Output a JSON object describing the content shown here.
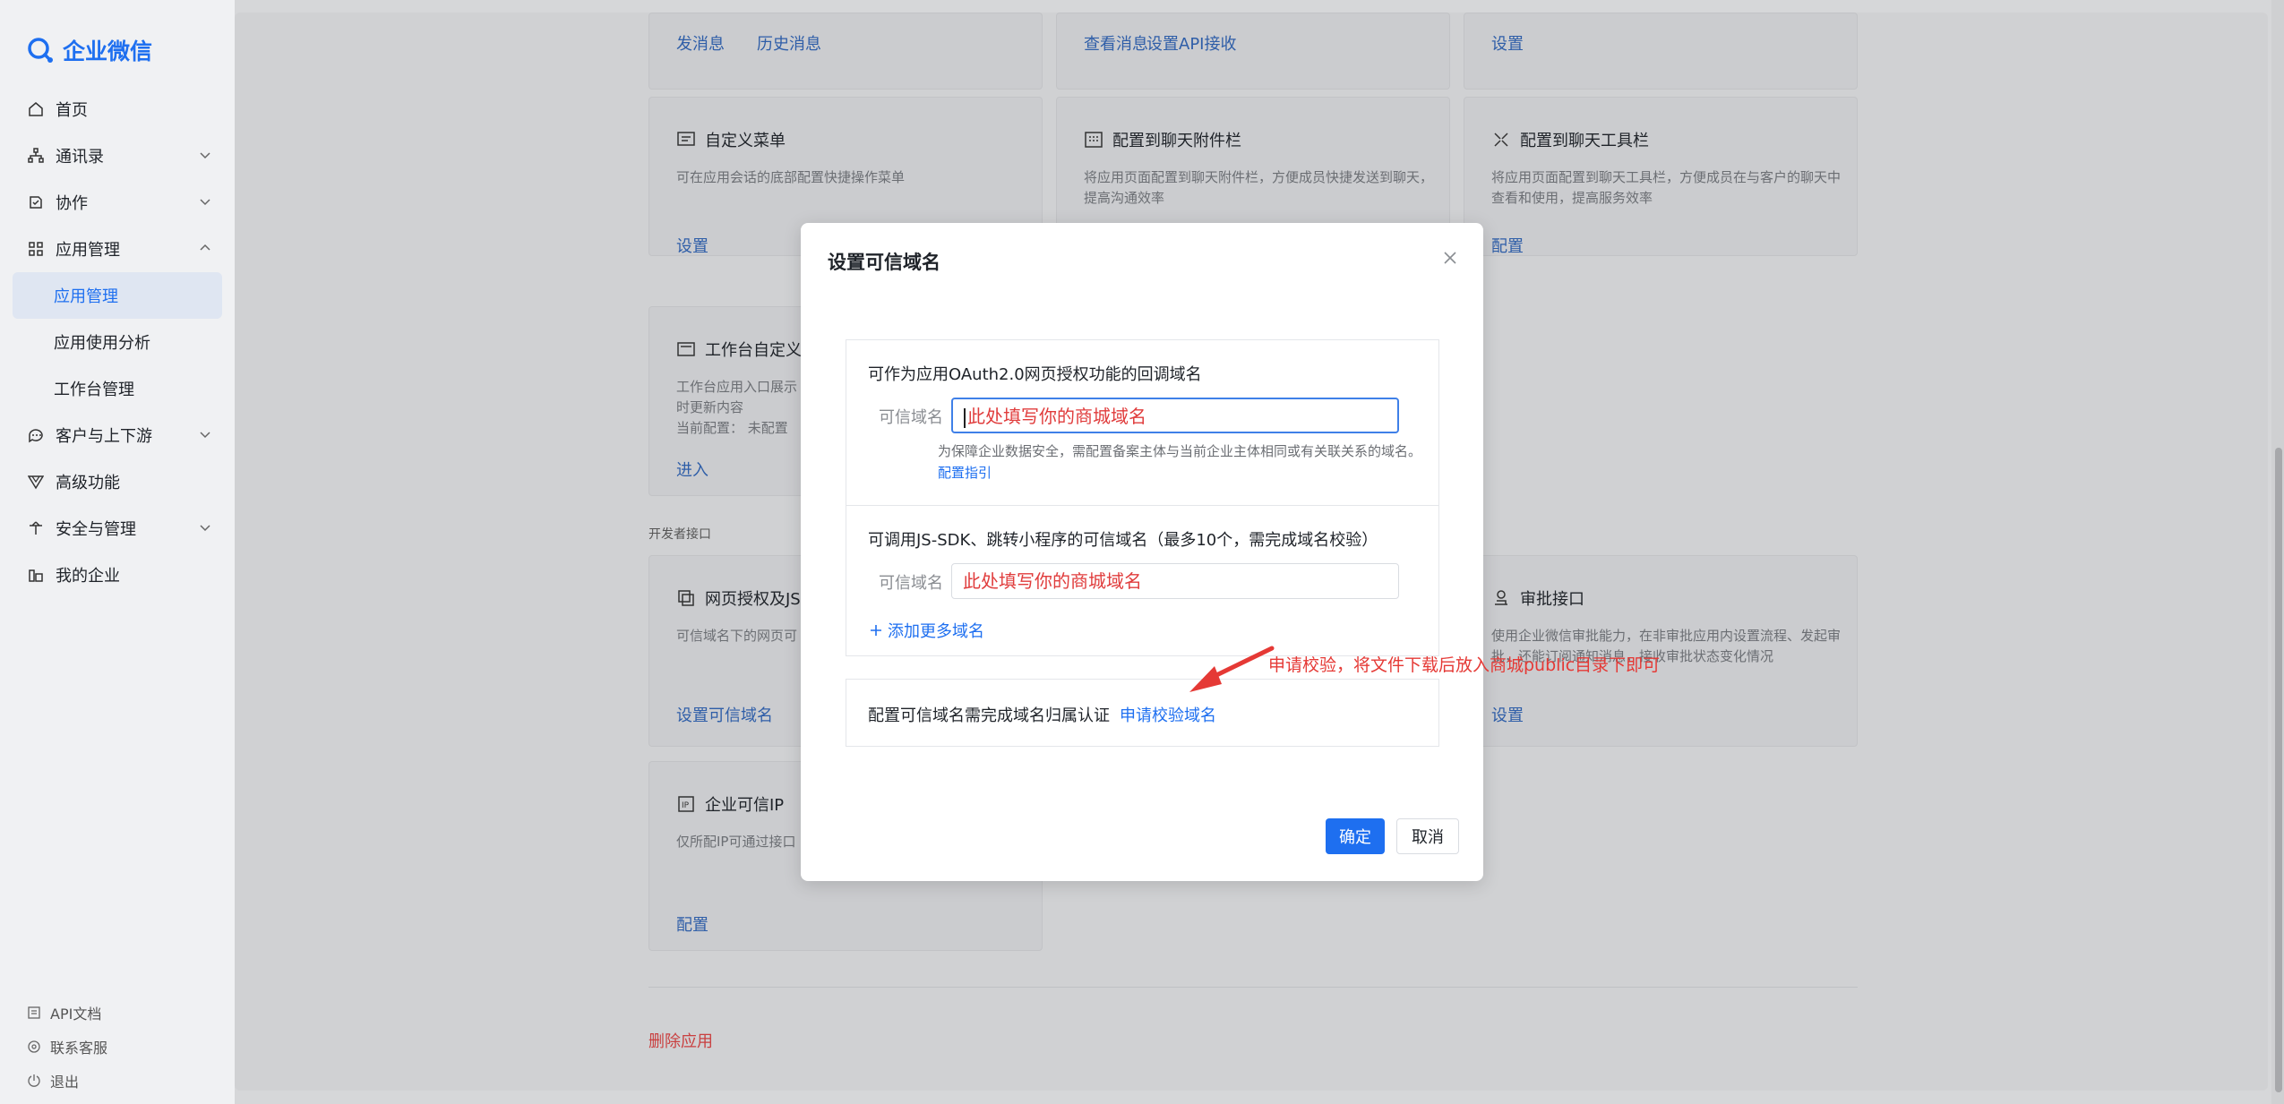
{
  "app": {
    "name": "企业微信"
  },
  "sidebar": {
    "items": [
      {
        "label": "首页",
        "icon": "home-icon"
      },
      {
        "label": "通讯录",
        "icon": "contacts-icon"
      },
      {
        "label": "协作",
        "icon": "collab-icon"
      },
      {
        "label": "应用管理",
        "icon": "apps-icon"
      },
      {
        "label": "应用管理",
        "sub": true,
        "active": true
      },
      {
        "label": "应用使用分析",
        "sub": true
      },
      {
        "label": "工作台管理",
        "sub": true
      },
      {
        "label": "客户与上下游",
        "icon": "customer-icon"
      },
      {
        "label": "高级功能",
        "icon": "advanced-icon"
      },
      {
        "label": "安全与管理",
        "icon": "security-icon"
      },
      {
        "label": "我的企业",
        "icon": "enterprise-icon"
      }
    ],
    "bottom": [
      {
        "label": "API文档",
        "icon": "doc-icon"
      },
      {
        "label": "联系客服",
        "icon": "support-icon"
      },
      {
        "label": "退出",
        "icon": "logout-icon"
      }
    ]
  },
  "main": {
    "top_row": {
      "card1": {
        "link1": "发消息",
        "link2": "历史消息"
      },
      "card2": {
        "link1": "查看消息",
        "link2": "设置API接收"
      },
      "card3": {
        "link1": "设置"
      }
    },
    "cards": {
      "custom_menu": {
        "title": "自定义菜单",
        "desc": "可在应用会话的底部配置快捷操作菜单",
        "link": "设置"
      },
      "chat_attach": {
        "title": "配置到聊天附件栏",
        "desc": "将应用页面配置到聊天附件栏，方便成员快捷发送到聊天，提高沟通效率"
      },
      "chat_toolbar": {
        "title": "配置到聊天工具栏",
        "desc": "将应用页面配置到聊天工具栏，方便成员在与客户的聊天中查看和使用，提高服务效率",
        "link": "配置"
      },
      "workbench": {
        "title": "工作台自定义",
        "desc1": "工作台应用入口展示",
        "desc2": "时更新内容",
        "current": "当前配置：  未配置",
        "link": "进入"
      },
      "web_auth": {
        "title": "网页授权及JS",
        "desc": "可信域名下的网页可",
        "link": "设置可信域名"
      },
      "approval": {
        "title": "审批接口",
        "desc": "使用企业微信审批能力，在非审批应用内设置流程、发起审批，还能订阅通知消息，接收审批状态变化情况",
        "link": "设置"
      },
      "trusted_ip": {
        "title": "企业可信IP",
        "desc": "仅所配IP可通过接口",
        "link": "配置"
      }
    },
    "section_dev": "开发者接口",
    "delete_app": "删除应用"
  },
  "modal": {
    "title": "设置可信域名",
    "section1": {
      "heading": "可作为应用OAuth2.0网页授权功能的回调域名",
      "label": "可信域名",
      "value": "此处填写你的商城域名",
      "hint": "为保障企业数据安全，需配置备案主体与当前企业主体相同或有关联关系的域名。",
      "hint_link": "配置指引"
    },
    "section2": {
      "heading": "可调用JS-SDK、跳转小程序的可信域名（最多10个，需完成域名校验）",
      "label": "可信域名",
      "value": "此处填写你的商城域名",
      "add_more": "添加更多域名"
    },
    "section3": {
      "text": "配置可信域名需完成域名归属认证",
      "link": "申请校验域名"
    },
    "ok": "确定",
    "cancel": "取消"
  },
  "annotation": {
    "text": "申请校验，将文件下载后放入商城public目录下即可",
    "color": "#e53935"
  }
}
